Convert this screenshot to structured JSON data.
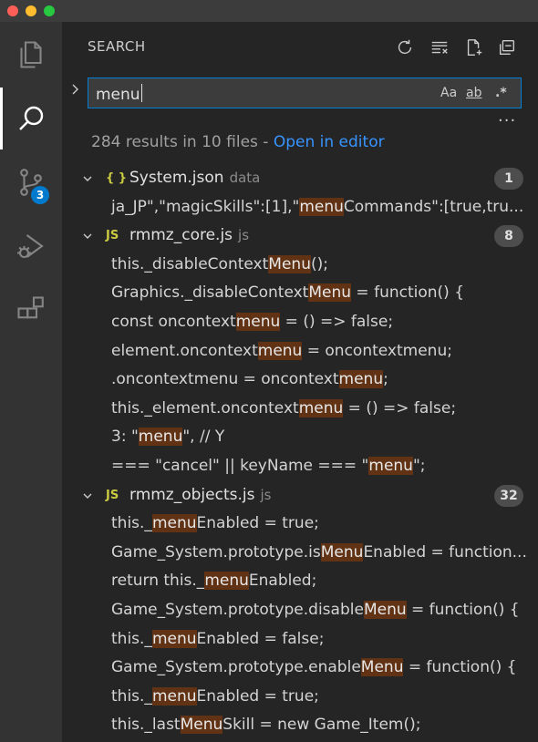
{
  "window": {
    "traffic_lights": [
      {
        "name": "close",
        "color": "#ff5f57"
      },
      {
        "name": "minimize",
        "color": "#febc2e"
      },
      {
        "name": "maximize",
        "color": "#28c840"
      }
    ]
  },
  "activity_bar": {
    "items": [
      {
        "name": "explorer",
        "icon": "files-icon"
      },
      {
        "name": "search",
        "icon": "search-icon",
        "active": true
      },
      {
        "name": "source-control",
        "icon": "source-control-icon",
        "badge": "3"
      },
      {
        "name": "run-debug",
        "icon": "run-debug-icon"
      },
      {
        "name": "extensions",
        "icon": "extensions-icon"
      }
    ]
  },
  "search_panel": {
    "title": "SEARCH",
    "toolbar": [
      "refresh-icon",
      "clear-results-icon",
      "new-search-editor-icon",
      "collapse-all-icon"
    ],
    "query": "menu",
    "options": {
      "match_case": "Aa",
      "whole_word": "ab",
      "regex": ".*"
    },
    "summary": {
      "text": "284 results in 10 files - ",
      "link": "Open in editor"
    },
    "files": [
      {
        "icon": "{ }",
        "name": "System.json",
        "dir": "data",
        "count": "1",
        "matches": [
          {
            "before": "ja_JP\",\"magicSkills\":[1],\"",
            "match": "menu",
            "after": "Commands\":[true,tru..."
          }
        ]
      },
      {
        "icon": "JS",
        "name": "rmmz_core.js",
        "dir": "js",
        "count": "8",
        "matches": [
          {
            "before": "this._disableContext",
            "match": "Menu",
            "after": "();"
          },
          {
            "before": "Graphics._disableContext",
            "match": "Menu",
            "after": " = function() {"
          },
          {
            "before": "const oncontext",
            "match": "menu",
            "after": " = () => false;"
          },
          {
            "before": "element.oncontext",
            "match": "menu",
            "after": " = oncontextmenu;"
          },
          {
            "before": ".oncontextmenu = oncontext",
            "match": "menu",
            "after": ";"
          },
          {
            "before": "this._element.oncontext",
            "match": "menu",
            "after": " = () => false;"
          },
          {
            "before": "3: \"",
            "match": "menu",
            "after": "\", // Y"
          },
          {
            "before": "=== \"cancel\" || keyName === \"",
            "match": "menu",
            "after": "\";"
          }
        ]
      },
      {
        "icon": "JS",
        "name": "rmmz_objects.js",
        "dir": "js",
        "count": "32",
        "matches": [
          {
            "before": "this._",
            "match": "menu",
            "after": "Enabled = true;"
          },
          {
            "before": "Game_System.prototype.is",
            "match": "Menu",
            "after": "Enabled = function..."
          },
          {
            "before": "return this._",
            "match": "menu",
            "after": "Enabled;"
          },
          {
            "before": "Game_System.prototype.disable",
            "match": "Menu",
            "after": " = function() {"
          },
          {
            "before": "this._",
            "match": "menu",
            "after": "Enabled = false;"
          },
          {
            "before": "Game_System.prototype.enable",
            "match": "Menu",
            "after": " = function() {"
          },
          {
            "before": "this._",
            "match": "menu",
            "after": "Enabled = true;"
          },
          {
            "before": "this._last",
            "match": "Menu",
            "after": "Skill = new Game_Item();"
          }
        ]
      }
    ]
  }
}
